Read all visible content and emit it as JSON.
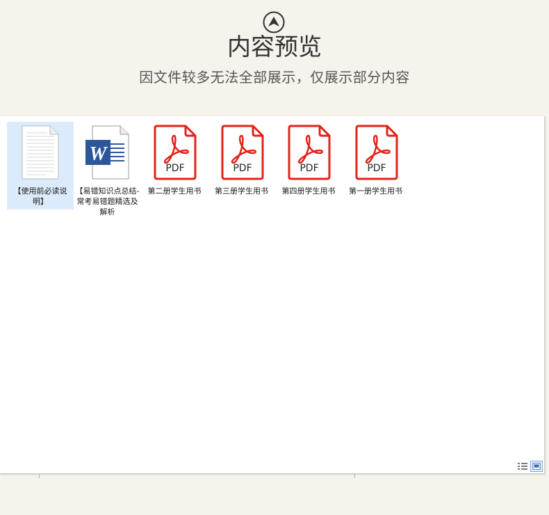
{
  "header": {
    "icon": "chevron-up-circle-icon",
    "title": "内容预览",
    "subtitle": "因文件较多无法全部展示，仅展示部分内容"
  },
  "files": [
    {
      "label": "【使用前必读说明】",
      "icon": "text-document-icon",
      "selected": true
    },
    {
      "label": "【易错知识点总结-常考易错题精选及解析",
      "icon": "word-document-icon",
      "selected": false
    },
    {
      "label": "第二册学生用书",
      "icon": "pdf-icon",
      "selected": false,
      "icon_text": "PDF"
    },
    {
      "label": "第三册学生用书",
      "icon": "pdf-icon",
      "selected": false,
      "icon_text": "PDF"
    },
    {
      "label": "第四册学生用书",
      "icon": "pdf-icon",
      "selected": false,
      "icon_text": "PDF"
    },
    {
      "label": "第一册学生用书",
      "icon": "pdf-icon",
      "selected": false,
      "icon_text": "PDF"
    }
  ],
  "colors": {
    "background": "#f6f2ec",
    "pdf_red": "#e2231a",
    "word_blue": "#2b579a",
    "selection": "#dcebfb"
  },
  "view_buttons": [
    "details-view-icon",
    "large-icons-view-icon"
  ]
}
